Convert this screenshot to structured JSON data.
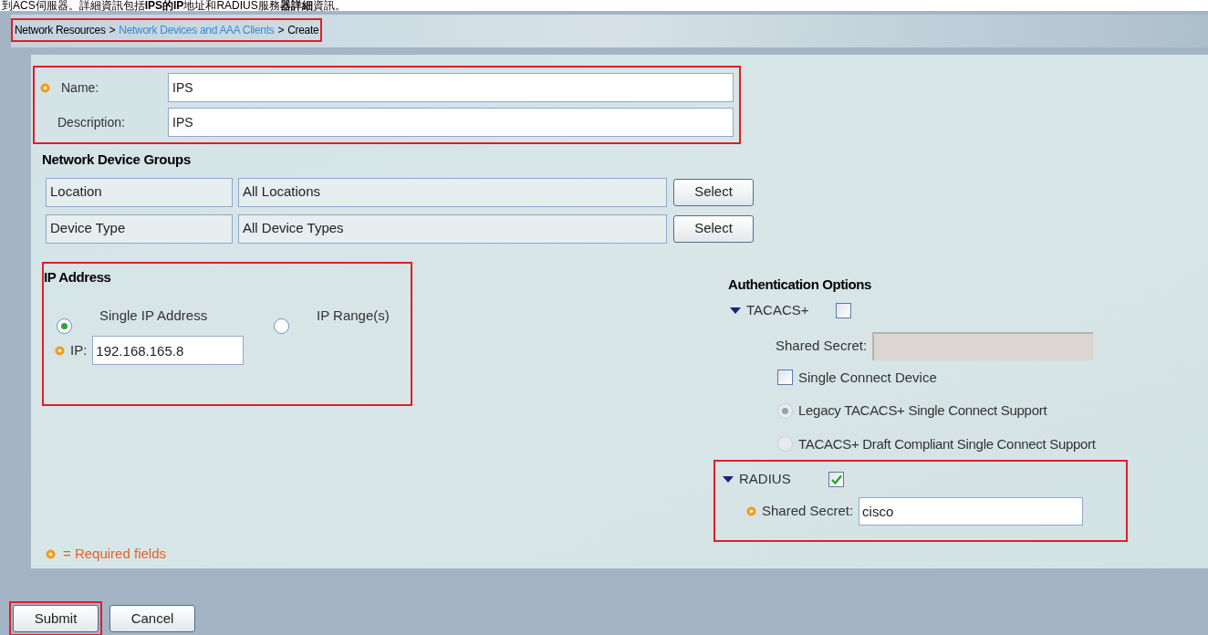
{
  "caption": "到ACS伺服器。詳細資訊包括**IPS的IP**地址和RADIUS服務**器詳細**資訊。",
  "breadcrumb": [
    {
      "text": "Network Resources",
      "link": false
    },
    {
      "text": ">",
      "link": false
    },
    {
      "text": "Network Devices and AAA Clients",
      "link": true
    },
    {
      "text": ">",
      "link": false
    },
    {
      "text": "Create",
      "link": false
    }
  ],
  "fields": [
    {
      "label": "Name:",
      "value": "IPS",
      "required": true
    },
    {
      "label": "Description:",
      "value": "IPS",
      "required": false
    }
  ],
  "device_groups": {
    "title": "Network Device Groups",
    "rows": [
      {
        "label": "Location",
        "value": "All Locations",
        "button": "Select"
      },
      {
        "label": "Device Type",
        "value": "All Device Types",
        "button": "Select"
      }
    ]
  },
  "ip_address": {
    "title": "IP Address",
    "options": [
      {
        "label": "Single IP Address",
        "selected": true
      },
      {
        "label": "IP Range(s)",
        "selected": false
      }
    ],
    "ip_label": "IP:",
    "ip_value": "192.168.165.8"
  },
  "authentication": {
    "title": "Authentication Options",
    "tacacs": {
      "label": "TACACS+",
      "checked": false,
      "secret_label": "Shared Secret:",
      "single_connect": {
        "label": "Single Connect Device",
        "checked": false
      },
      "modes": [
        {
          "label": "Legacy TACACS+ Single Connect Support",
          "selected": true
        },
        {
          "label": "TACACS+ Draft Compliant Single Connect Support",
          "selected": false
        }
      ]
    },
    "radius": {
      "label": "RADIUS",
      "checked": true,
      "secret_label": "Shared Secret:",
      "secret_value": "cisco"
    }
  },
  "required_note": "= Required fields",
  "buttons": [
    "Submit",
    "Cancel"
  ]
}
